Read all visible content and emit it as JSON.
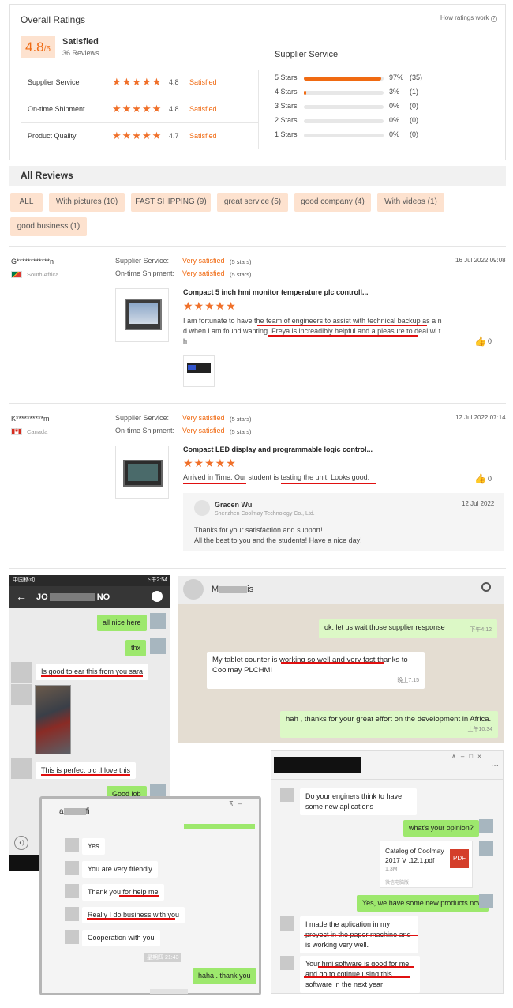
{
  "overall": {
    "title": "Overall Ratings",
    "how": "How ratings work",
    "score": "4.8",
    "out_of": "/5",
    "status": "Satisfied",
    "count": "36 Reviews"
  },
  "ratings": [
    {
      "label": "Supplier Service",
      "score": "4.8",
      "status": "Satisfied"
    },
    {
      "label": "On-time Shipment",
      "score": "4.8",
      "status": "Satisfied"
    },
    {
      "label": "Product Quality",
      "score": "4.7",
      "status": "Satisfied"
    }
  ],
  "supplier_service": {
    "title": "Supplier Service",
    "rows": [
      {
        "label": "5 Stars",
        "pct": "97%",
        "count": "(35)",
        "fill": 0.97
      },
      {
        "label": "4 Stars",
        "pct": "3%",
        "count": "(1)",
        "fill": 0.03
      },
      {
        "label": "3 Stars",
        "pct": "0%",
        "count": "(0)",
        "fill": 0
      },
      {
        "label": "2 Stars",
        "pct": "0%",
        "count": "(0)",
        "fill": 0
      },
      {
        "label": "1 Stars",
        "pct": "0%",
        "count": "(0)",
        "fill": 0
      }
    ]
  },
  "all_reviews": {
    "title": "All Reviews",
    "filters": [
      "ALL",
      "With pictures (10)",
      "FAST SHIPPING (9)",
      "great service (5)",
      "good company (4)",
      "With videos (1)",
      "good business (1)"
    ]
  },
  "reviews": [
    {
      "user": "G************n",
      "country": "South Africa",
      "ss_label": "Supplier Service:",
      "ss_val": "Very satisfied",
      "ss_stars": "(5 stars)",
      "os_label": "On-time Shipment:",
      "os_val": "Very satisfied",
      "os_stars": "(5 stars)",
      "date": "16 Jul 2022 09:08",
      "product": "Compact 5 inch hmi monitor temperature plc controll...",
      "text": "I am fortunate to have the team of engineers to assist with technical backup as a nd when i am found wanting. Freya is increadibly helpful and a pleasure to deal wi th",
      "likes": "0"
    },
    {
      "user": "K**********m",
      "country": "Canada",
      "ss_label": "Supplier Service:",
      "ss_val": "Very satisfied",
      "ss_stars": "(5 stars)",
      "os_label": "On-time Shipment:",
      "os_val": "Very satisfied",
      "os_stars": "(5 stars)",
      "date": "12 Jul 2022 07:14",
      "product": "Compact LED display and programmable logic control...",
      "text": "Arrived in Time. Our student is testing the unit. Looks good.",
      "likes": "0",
      "reply": {
        "name": "Gracen Wu",
        "company": "Shenzhen Coolmay Technology Co., Ltd.",
        "date": "12 Jul 2022",
        "line1": "Thanks for your satisfaction and support!",
        "line2": "All the best to you and the students! Have a nice day!"
      }
    }
  ],
  "chat1": {
    "status_left": "中国移动",
    "status_right": "下午2:54",
    "title_a": "JO",
    "title_b": "NO",
    "msgs": [
      "all nice here",
      "thx",
      "Is good to ear this from you sara",
      "This is perfect plc ,I love this",
      "Good job"
    ]
  },
  "chat2": {
    "name_a": "M",
    "name_b": "is",
    "msgs": [
      "ok. let us wait those supplier response",
      "My tablet counter is working so well and very fast thanks to Coolmay PLCHMI",
      "hah , thanks for your great effort on the development in Africa."
    ],
    "times": [
      "下午4:12",
      "晚上7:15",
      "上午10:34"
    ]
  },
  "chat3": {
    "name_a": "a",
    "name_b": "fi",
    "msgs": [
      "Yes",
      "You are very friendly",
      "Thank you for help me",
      "Really I do business with you",
      "Cooperation with you",
      "haha . thank you"
    ],
    "time": "星期四 21:43"
  },
  "chat4": {
    "msgs": [
      "Do your enginers think to have some new aplications",
      "what's your opinion?",
      "Yes, we have some new products now",
      "I made the aplication in my proyect in the paper machine and is working very well.",
      "Your hmi software is good for me and go to cotinue using this software in the next year"
    ],
    "file_name": "Catalog of Coolmay 2017 V .12.1.pdf",
    "file_size": "1.3M",
    "file_tag": "PDF",
    "file_source": "微信电脑版"
  }
}
